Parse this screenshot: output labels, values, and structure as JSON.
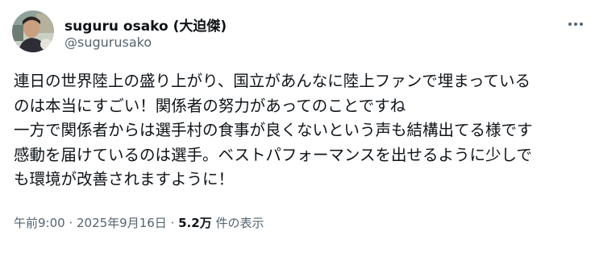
{
  "author": {
    "display_name": "suguru osako (大迫傑)",
    "handle": "@sugurusako"
  },
  "post": {
    "lines": [
      "連日の世界陸上の盛り上がり、国立があんなに陸上ファンで埋まっている",
      "のは本当にすごい！関係者の努力があってのことですね",
      "一方で関係者からは選手村の食事が良くないという声も結構出てる様です",
      "感動を届けているのは選手。ベストパフォーマンスを出せるように少しで",
      "も環境が改善されますように！"
    ]
  },
  "meta": {
    "time": "午前9:00",
    "sep1": " · ",
    "date": "2025年9月16日",
    "sep2": " · ",
    "views_count": "5.2万",
    "views_label": " 件の表示"
  },
  "icons": {
    "more": "more-horizontal-icon",
    "avatar": "profile-photo"
  },
  "colors": {
    "text_primary": "#0f1419",
    "text_secondary": "#536471",
    "background": "#ffffff"
  }
}
